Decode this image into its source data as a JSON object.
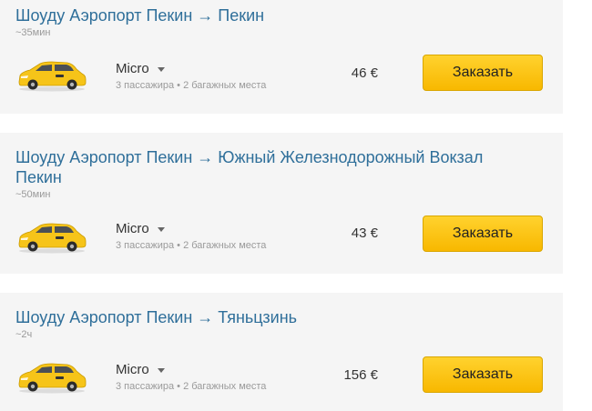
{
  "trips": [
    {
      "route": "Шоуду Аэропорт Пекин → Пекин",
      "duration": "~35мин",
      "car_class": "Micro",
      "capacity": "3 пассажира • 2 багажных места",
      "price": "46 €",
      "button_label": "Заказать"
    },
    {
      "route": "Шоуду Аэропорт Пекин → Южный Железнодорожный Вокзал Пекин",
      "duration": "~50мин",
      "car_class": "Micro",
      "capacity": "3 пассажира • 2 багажных места",
      "price": "43 €",
      "button_label": "Заказать"
    },
    {
      "route": "Шоуду Аэропорт Пекин → Тяньцзинь",
      "duration": "~2ч",
      "car_class": "Micro",
      "capacity": "3 пассажира • 2 багажных места",
      "price": "156 €",
      "button_label": "Заказать"
    }
  ],
  "icons": {
    "car": "yellow-taxi-car-icon",
    "class_dropdown": "chevron-down-icon"
  },
  "colors": {
    "route_link": "#2f6f9a",
    "button": "#fcc51c",
    "card_background": "#f5f5f5",
    "taxi": "#f6c419"
  }
}
